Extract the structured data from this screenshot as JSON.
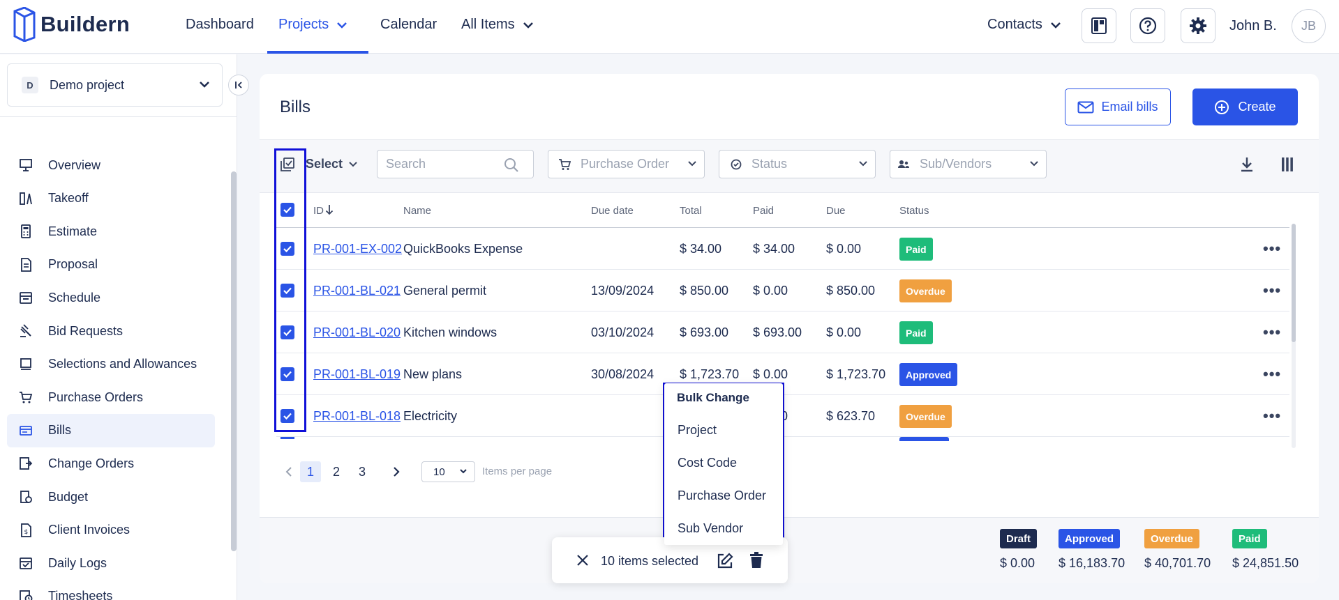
{
  "app": {
    "name": "Buildern"
  },
  "nav": {
    "dashboard": "Dashboard",
    "projects": "Projects",
    "calendar": "Calendar",
    "all_items": "All Items",
    "contacts": "Contacts"
  },
  "user": {
    "name": "John B.",
    "initials": "JB"
  },
  "sidebar": {
    "project": {
      "badge": "D",
      "name": "Demo project"
    },
    "items": [
      {
        "label": "Overview",
        "icon": "presentation-icon"
      },
      {
        "label": "Takeoff",
        "icon": "ruler-icon"
      },
      {
        "label": "Estimate",
        "icon": "calculator-icon"
      },
      {
        "label": "Proposal",
        "icon": "document-icon"
      },
      {
        "label": "Schedule",
        "icon": "calendar-icon"
      },
      {
        "label": "Bid Requests",
        "icon": "gavel-icon"
      },
      {
        "label": "Selections and Allowances",
        "icon": "list-icon"
      },
      {
        "label": "Purchase Orders",
        "icon": "cart-icon"
      },
      {
        "label": "Bills",
        "icon": "bills-icon"
      },
      {
        "label": "Change Orders",
        "icon": "change-icon"
      },
      {
        "label": "Budget",
        "icon": "budget-icon"
      },
      {
        "label": "Client Invoices",
        "icon": "invoice-icon"
      },
      {
        "label": "Daily Logs",
        "icon": "calendar-check-icon"
      },
      {
        "label": "Timesheets",
        "icon": "timesheet-icon"
      }
    ],
    "active": "Bills"
  },
  "page": {
    "title": "Bills",
    "email_label": "Email bills",
    "create_label": "Create"
  },
  "toolbar": {
    "select_label": "Select",
    "search_placeholder": "Search",
    "purchase_order": "Purchase Order",
    "status": "Status",
    "sub_vendors": "Sub/Vendors"
  },
  "table": {
    "columns": [
      "ID",
      "Name",
      "Due date",
      "Total",
      "Paid",
      "Due",
      "Status"
    ],
    "rows": [
      {
        "id": "PR-001-EX-002",
        "name": "QuickBooks Expense",
        "due_date": "",
        "total": "$ 34.00",
        "paid": "$ 34.00",
        "due": "$ 0.00",
        "status": "Paid"
      },
      {
        "id": "PR-001-BL-021",
        "name": "General permit",
        "due_date": "13/09/2024",
        "total": "$ 850.00",
        "paid": "$ 0.00",
        "due": "$ 850.00",
        "status": "Overdue"
      },
      {
        "id": "PR-001-BL-020",
        "name": "Kitchen windows",
        "due_date": "03/10/2024",
        "total": "$ 693.00",
        "paid": "$ 693.00",
        "due": "$ 0.00",
        "status": "Paid"
      },
      {
        "id": "PR-001-BL-019",
        "name": "New plans",
        "due_date": "30/08/2024",
        "total": "$ 1,723.70",
        "paid": "$ 0.00",
        "due": "$ 1,723.70",
        "status": "Approved"
      },
      {
        "id": "PR-001-BL-018",
        "name": "Electricity",
        "due_date": "",
        "total": "$ 623.70",
        "paid": "$ 0.00",
        "due": "$ 623.70",
        "status": "Overdue"
      }
    ]
  },
  "pagination": {
    "pages": [
      "1",
      "2",
      "3"
    ],
    "current": "1",
    "per_page": "10",
    "per_page_label": "Items per page"
  },
  "summary": [
    {
      "label": "Draft",
      "value": "$ 0.00",
      "color": "#1d2b4f"
    },
    {
      "label": "Approved",
      "value": "$ 16,183.70",
      "color": "#2a54e6"
    },
    {
      "label": "Overdue",
      "value": "$ 40,701.70",
      "color": "#f0a040"
    },
    {
      "label": "Paid",
      "value": "$ 24,851.50",
      "color": "#1ebc7a"
    }
  ],
  "bulk_menu": {
    "title": "Bulk Change",
    "items": [
      "Project",
      "Cost Code",
      "Purchase Order",
      "Sub Vendor"
    ]
  },
  "bulk_bar": {
    "selected_text": "10 items selected"
  },
  "colors": {
    "accent": "#2a54e6",
    "paid": "#1ebc7a",
    "overdue": "#f0a040",
    "approved": "#2a54e6",
    "draft": "#1d2b4f",
    "highlight": "#1010d8"
  }
}
